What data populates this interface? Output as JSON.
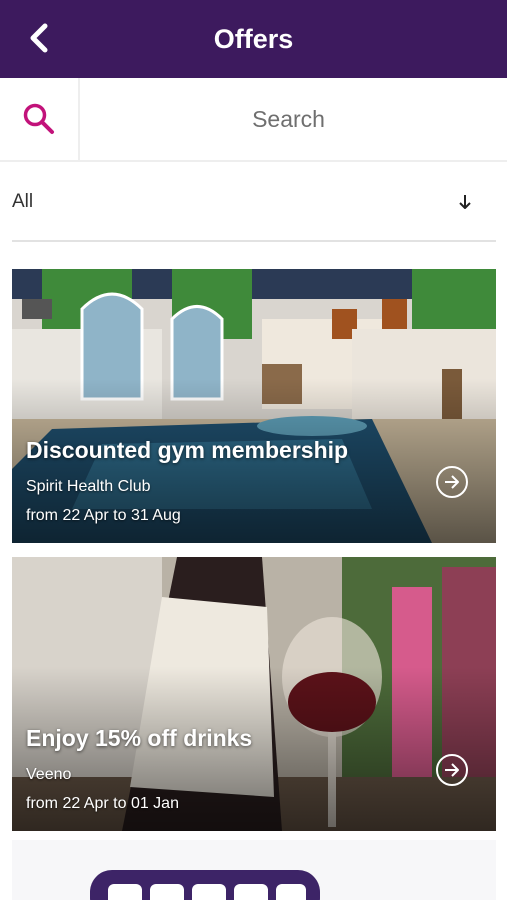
{
  "header": {
    "title": "Offers",
    "back_icon": "chevron-left-icon",
    "background": "#3d1a5e"
  },
  "search": {
    "placeholder": "Search",
    "value": "",
    "icon": "search-icon",
    "icon_color": "#c2127a"
  },
  "filter": {
    "label": "All",
    "icon": "arrow-down-icon"
  },
  "offers": [
    {
      "title": "Discounted gym membership",
      "venue": "Spirit Health Club",
      "dates": "from 22 Apr to 31 Aug",
      "image": "indoor swimming pool",
      "action_icon": "arrow-right-circle-icon"
    },
    {
      "title": "Enjoy 15% off drinks",
      "venue": "Veeno",
      "dates": "from 22 Apr to 01 Jan",
      "image": "wine bottle and glass",
      "action_icon": "arrow-right-circle-icon"
    },
    {
      "image": "partially visible illustration"
    }
  ]
}
